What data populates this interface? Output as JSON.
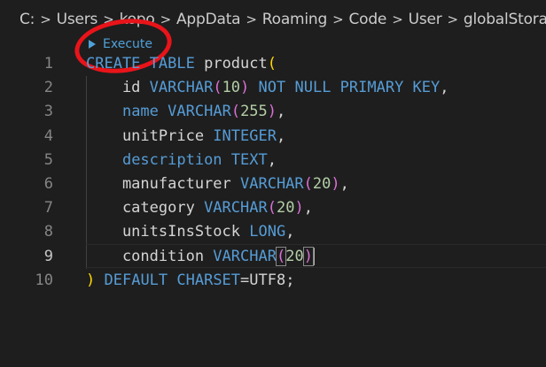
{
  "breadcrumb": {
    "items": [
      "C:",
      "Users",
      "kopo",
      "AppData",
      "Roaming",
      "Code",
      "User",
      "globalStorage"
    ],
    "separator": ">"
  },
  "codelens": {
    "execute_label": "Execute"
  },
  "colors": {
    "background": "#1e1e1e",
    "keyword": "#569cd6",
    "identifier": "#d4d4d4",
    "number": "#b5cea8",
    "bracket_level1": "#ffd700",
    "bracket_level2": "#da70d6",
    "annotation_circle": "#e8141a",
    "codelens": "#4fa2d9"
  },
  "editor": {
    "active_line": 9,
    "lines": [
      {
        "number": "1",
        "tokens": [
          {
            "t": "CREATE",
            "c": "kw"
          },
          {
            "t": " ",
            "c": "id"
          },
          {
            "t": "TABLE",
            "c": "kw"
          },
          {
            "t": " product",
            "c": "id"
          },
          {
            "t": "(",
            "c": "br1"
          }
        ]
      },
      {
        "number": "2",
        "tokens": [
          {
            "t": "    id ",
            "c": "id"
          },
          {
            "t": "VARCHAR",
            "c": "kw"
          },
          {
            "t": "(",
            "c": "br2"
          },
          {
            "t": "10",
            "c": "num"
          },
          {
            "t": ")",
            "c": "br2"
          },
          {
            "t": " ",
            "c": "id"
          },
          {
            "t": "NOT NULL PRIMARY KEY",
            "c": "kw"
          },
          {
            "t": ",",
            "c": "id"
          }
        ]
      },
      {
        "number": "3",
        "tokens": [
          {
            "t": "    ",
            "c": "id"
          },
          {
            "t": "name",
            "c": "kw"
          },
          {
            "t": " ",
            "c": "id"
          },
          {
            "t": "VARCHAR",
            "c": "kw"
          },
          {
            "t": "(",
            "c": "br2"
          },
          {
            "t": "255",
            "c": "num"
          },
          {
            "t": ")",
            "c": "br2"
          },
          {
            "t": ",",
            "c": "id"
          }
        ]
      },
      {
        "number": "4",
        "tokens": [
          {
            "t": "    unitPrice ",
            "c": "id"
          },
          {
            "t": "INTEGER",
            "c": "kw"
          },
          {
            "t": ",",
            "c": "id"
          }
        ]
      },
      {
        "number": "5",
        "tokens": [
          {
            "t": "    ",
            "c": "id"
          },
          {
            "t": "description",
            "c": "kw"
          },
          {
            "t": " ",
            "c": "id"
          },
          {
            "t": "TEXT",
            "c": "kw"
          },
          {
            "t": ",",
            "c": "id"
          }
        ]
      },
      {
        "number": "6",
        "tokens": [
          {
            "t": "    manufacturer ",
            "c": "id"
          },
          {
            "t": "VARCHAR",
            "c": "kw"
          },
          {
            "t": "(",
            "c": "br2"
          },
          {
            "t": "20",
            "c": "num"
          },
          {
            "t": ")",
            "c": "br2"
          },
          {
            "t": ",",
            "c": "id"
          }
        ]
      },
      {
        "number": "7",
        "tokens": [
          {
            "t": "    category ",
            "c": "id"
          },
          {
            "t": "VARCHAR",
            "c": "kw"
          },
          {
            "t": "(",
            "c": "br2"
          },
          {
            "t": "20",
            "c": "num"
          },
          {
            "t": ")",
            "c": "br2"
          },
          {
            "t": ",",
            "c": "id"
          }
        ]
      },
      {
        "number": "8",
        "tokens": [
          {
            "t": "    unitsInsStock ",
            "c": "id"
          },
          {
            "t": "LONG",
            "c": "kw"
          },
          {
            "t": ",",
            "c": "id"
          }
        ]
      },
      {
        "number": "9",
        "tokens": [
          {
            "t": "    condition ",
            "c": "id"
          },
          {
            "t": "VARCHAR",
            "c": "kw"
          },
          {
            "t": "(",
            "c": "br2",
            "match": true
          },
          {
            "t": "20",
            "c": "num"
          },
          {
            "t": ")",
            "c": "br2",
            "match": true
          }
        ]
      },
      {
        "number": "10",
        "tokens": [
          {
            "t": ")",
            "c": "br1"
          },
          {
            "t": " ",
            "c": "id"
          },
          {
            "t": "DEFAULT CHARSET",
            "c": "kw"
          },
          {
            "t": "=UTF8;",
            "c": "id"
          }
        ]
      }
    ]
  }
}
